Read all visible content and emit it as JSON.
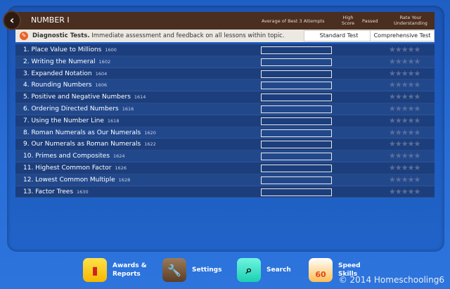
{
  "header": {
    "back": "‹",
    "title": "NUMBER I",
    "col_average": "Average of Best 3 Attempts",
    "col_high": "High Score",
    "col_passed": "Passed",
    "col_rate": "Rate Your Understanding"
  },
  "diagnostic": {
    "bold": "Diagnostic Tests.",
    "text": " Immediate assessment and feedback on all lessons within topic.",
    "standard": "Standard Test",
    "comprehensive": "Comprehensive Test"
  },
  "lessons": [
    {
      "name": "1. Place Value to Millions",
      "code": "1600"
    },
    {
      "name": "2. Writing the Numeral",
      "code": "1602"
    },
    {
      "name": "3. Expanded Notation",
      "code": "1604"
    },
    {
      "name": "4. Rounding Numbers",
      "code": "1606"
    },
    {
      "name": "5. Positive and Negative Numbers",
      "code": "1614"
    },
    {
      "name": "6. Ordering Directed Numbers",
      "code": "1616"
    },
    {
      "name": "7. Using the Number Line",
      "code": "1618"
    },
    {
      "name": "8. Roman Numerals as Our Numerals",
      "code": "1620"
    },
    {
      "name": "9. Our Numerals as Roman Numerals",
      "code": "1622"
    },
    {
      "name": "10. Primes and Composites",
      "code": "1624"
    },
    {
      "name": "11. Highest Common Factor",
      "code": "1626"
    },
    {
      "name": "12. Lowest Common Multiple",
      "code": "1628"
    },
    {
      "name": "13. Factor Trees",
      "code": "1630"
    }
  ],
  "stars": "★★★★★",
  "dock": {
    "awards": "Awards & Reports",
    "settings": "Settings",
    "search": "Search",
    "speed": "Speed Skills",
    "speed_value": "60"
  },
  "watermark": "© 2014 Homeschooling6"
}
